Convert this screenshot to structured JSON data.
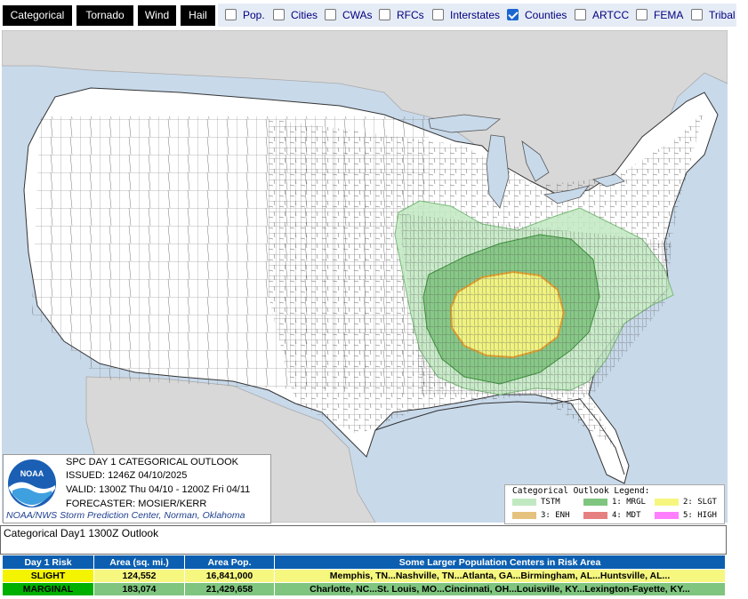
{
  "toolbar": {
    "tabs": [
      "Categorical",
      "Tornado",
      "Wind",
      "Hail"
    ],
    "options": [
      {
        "label": "Pop.",
        "checked": false
      },
      {
        "label": "Cities",
        "checked": false
      },
      {
        "label": "CWAs",
        "checked": false
      },
      {
        "label": "RFCs",
        "checked": false
      },
      {
        "label": "Interstates",
        "checked": false
      },
      {
        "label": "Counties",
        "checked": true
      },
      {
        "label": "ARTCC",
        "checked": false
      },
      {
        "label": "FEMA",
        "checked": false
      },
      {
        "label": "Tribal",
        "checked": false
      }
    ]
  },
  "info": {
    "title": "SPC DAY 1 CATEGORICAL OUTLOOK",
    "issued": "ISSUED: 1246Z 04/10/2025",
    "valid": "VALID: 1300Z Thu 04/10 - 1200Z Fri 04/11",
    "forecaster": "FORECASTER: MOSIER/KERR",
    "footer": "NOAA/NWS Storm Prediction Center, Norman, Oklahoma",
    "logo_text": "NOAA"
  },
  "legend": {
    "title": "Categorical Outlook Legend:",
    "items": [
      {
        "label": "TSTM",
        "color": "#c1e9c1"
      },
      {
        "label": "1: MRGL",
        "color": "#7fc57f"
      },
      {
        "label": "2: SLGT",
        "color": "#f6f67f"
      },
      {
        "label": "3: ENH",
        "color": "#e6c27f"
      },
      {
        "label": "4: MDT",
        "color": "#e67f7f"
      },
      {
        "label": "5: HIGH",
        "color": "#ff7fff"
      }
    ]
  },
  "caption": "Categorical Day1 1300Z Outlook",
  "table": {
    "headers": [
      "Day 1 Risk",
      "Area (sq. mi.)",
      "Area Pop.",
      "Some Larger Population Centers in Risk Area"
    ],
    "rows": [
      {
        "risk": "SLIGHT",
        "area": "124,552",
        "pop": "16,841,000",
        "centers": "Memphis, TN...Nashville, TN...Atlanta, GA...Birmingham, AL...Huntsville, AL..."
      },
      {
        "risk": "MARGINAL",
        "area": "183,074",
        "pop": "21,429,658",
        "centers": "Charlotte, NC...St. Louis, MO...Cincinnati, OH...Louisville, KY...Lexington-Fayette, KY..."
      }
    ]
  }
}
